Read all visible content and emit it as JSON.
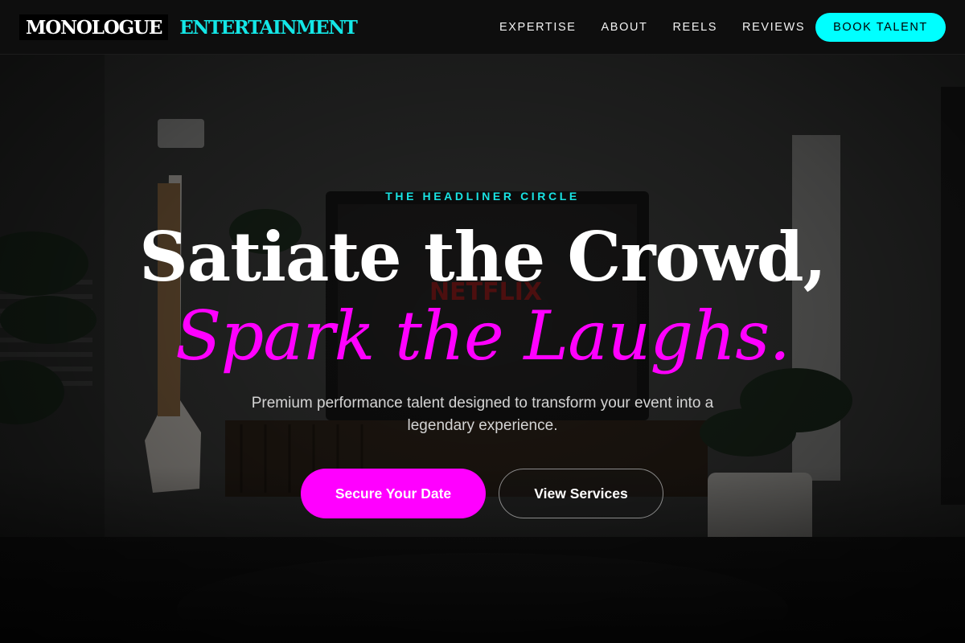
{
  "brand": {
    "name": "MONOLOGUE",
    "accent": "ENTERTAINMENT",
    "accent_color": "#14e6e6"
  },
  "nav": {
    "links": [
      {
        "label": "EXPERTISE"
      },
      {
        "label": "ABOUT"
      },
      {
        "label": "REELS"
      },
      {
        "label": "REVIEWS"
      }
    ],
    "cta_label": "BOOK TALENT",
    "cta_color": "#00ffff"
  },
  "hero": {
    "eyebrow": "THE HEADLINER CIRCLE",
    "headline": "Satiate the Crowd,",
    "headline_accent": "Spark the Laughs.",
    "accent_color": "#ff00ff",
    "subtext": "Premium performance talent designed to transform your event into a legendary experience.",
    "primary_button": "Secure Your Date",
    "secondary_button": "View Services"
  }
}
